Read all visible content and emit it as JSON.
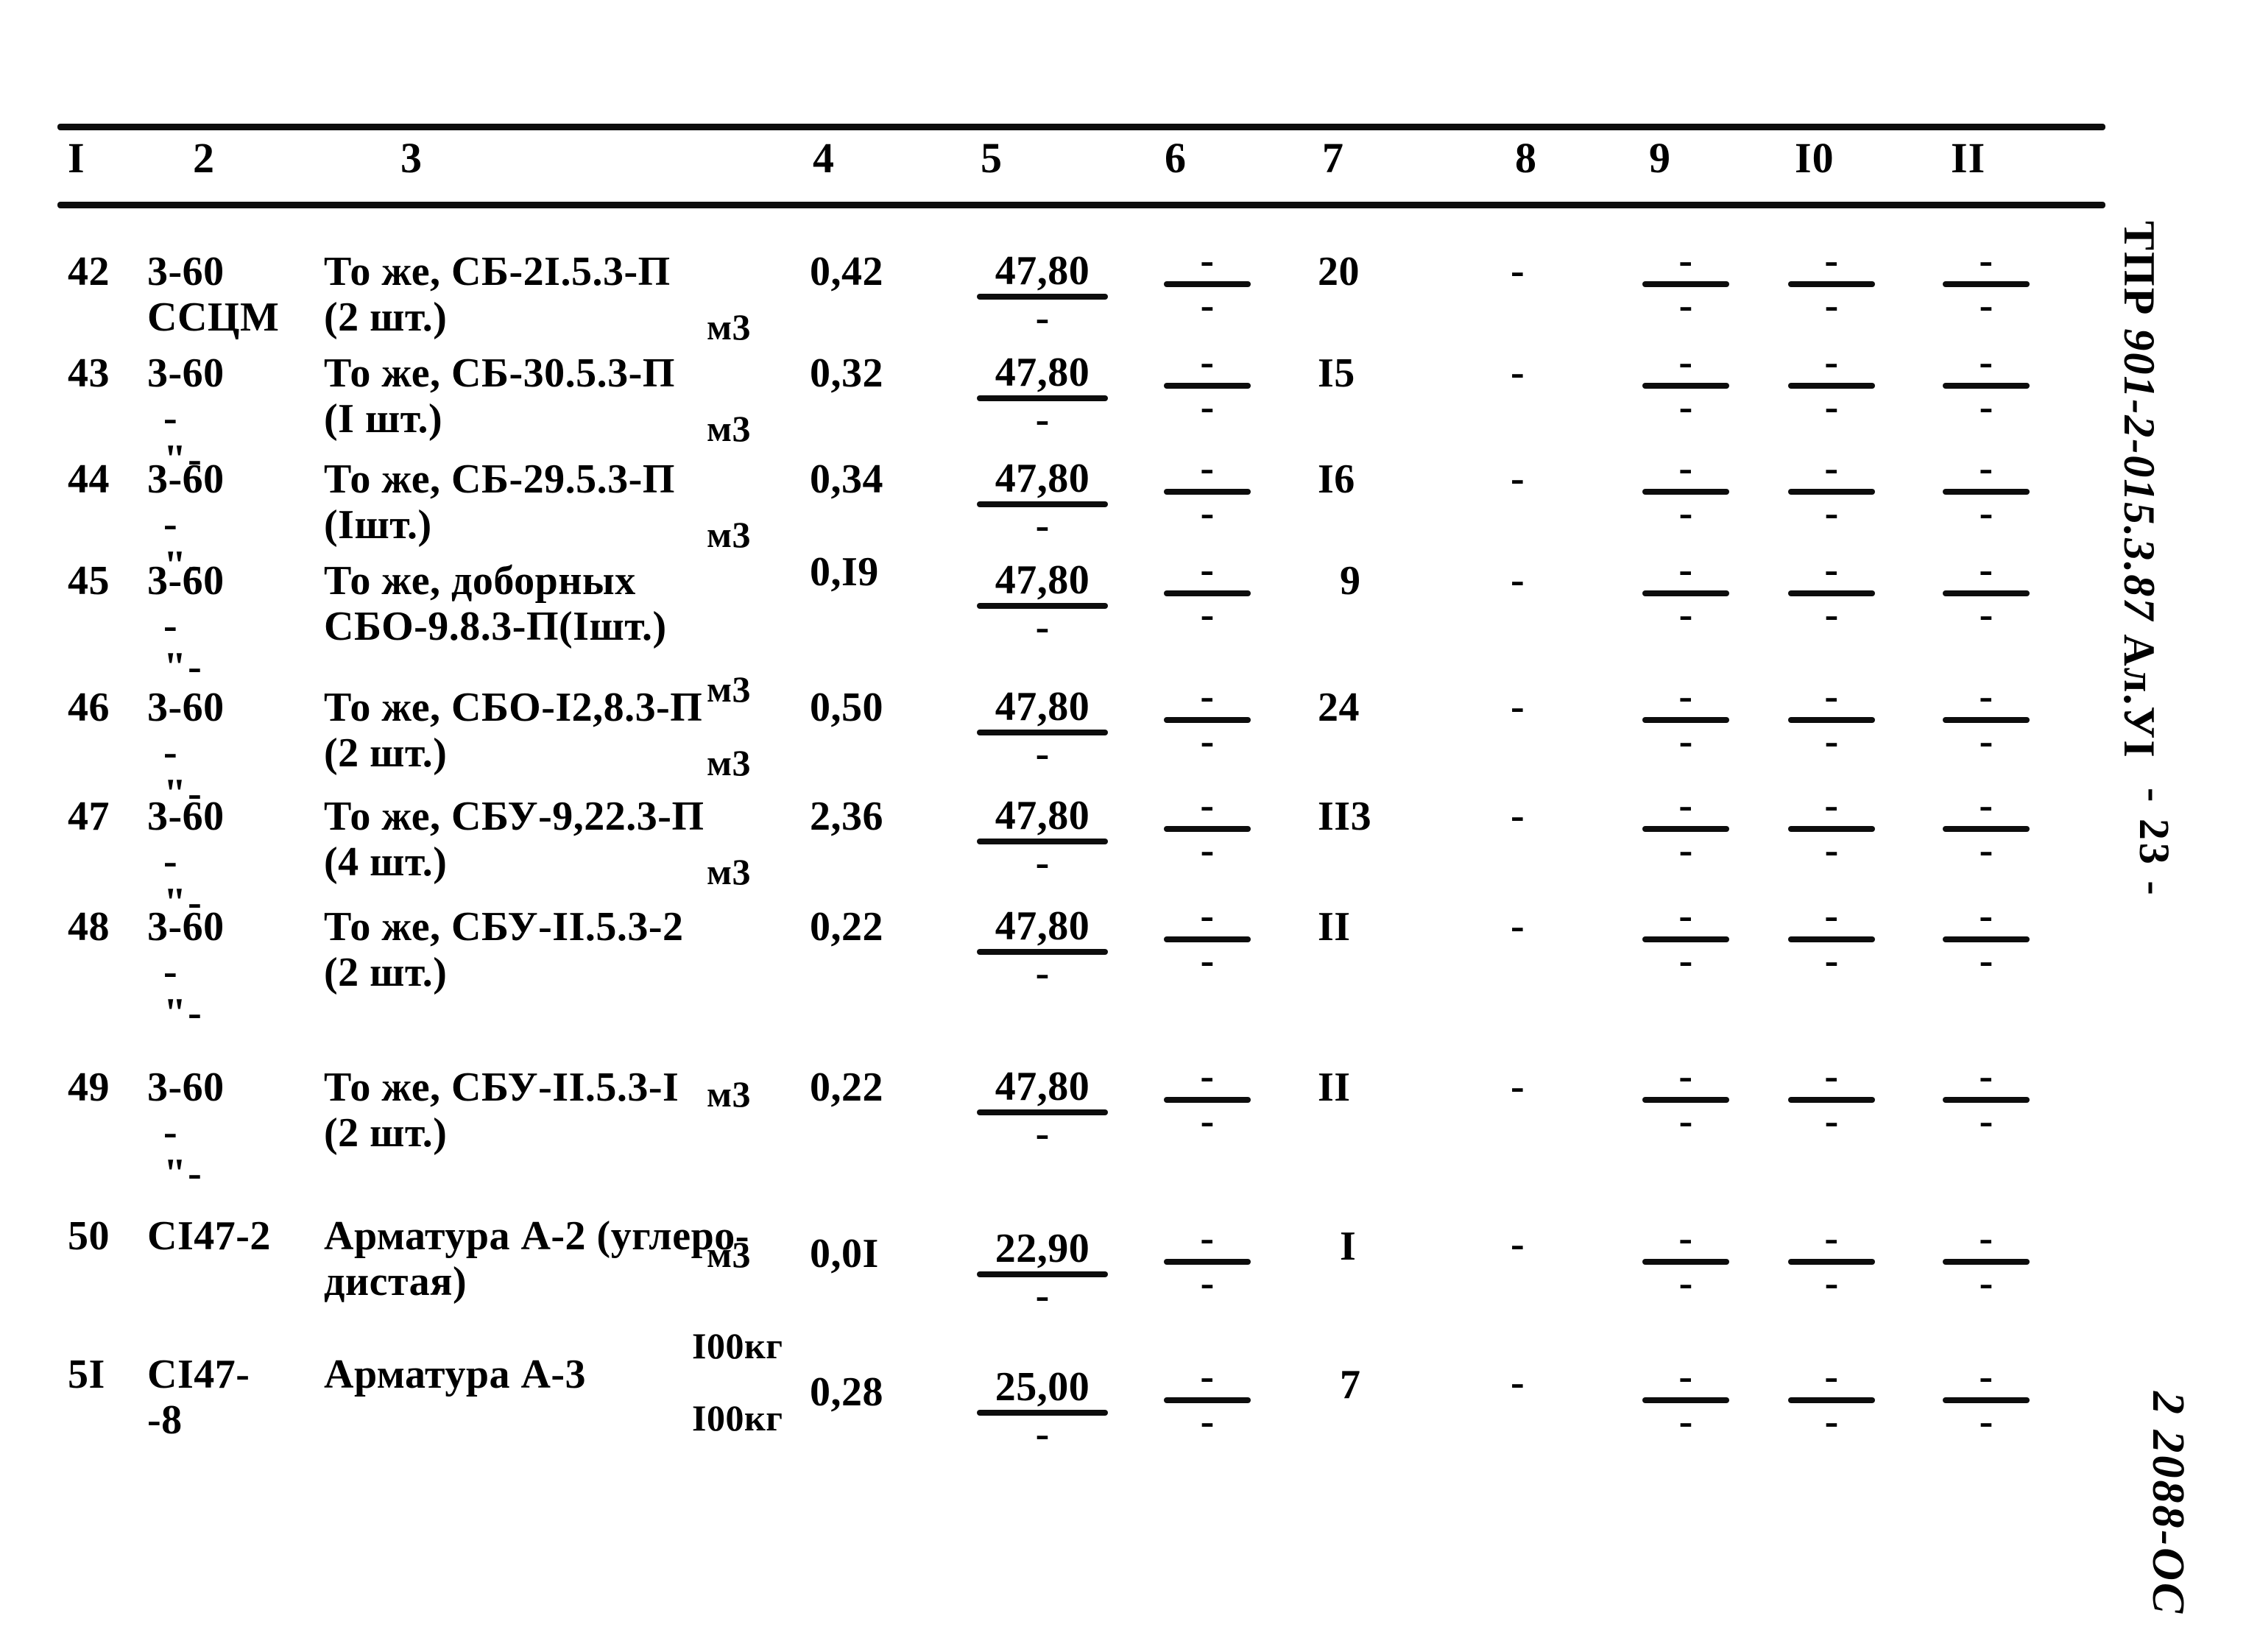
{
  "document": {
    "margin_code": "ТПР 901-2-015.3.87  Ал.УI",
    "page_marker": "- 23 -",
    "bottom_stamp": "2 2088-ОС"
  },
  "table": {
    "headers": [
      "I",
      "2",
      "3",
      "4",
      "5",
      "6",
      "7",
      "8",
      "9",
      "I0",
      "II"
    ],
    "rows": [
      {
        "c1": "42",
        "c2_line1": "3-60",
        "c2_line2": "ССЦМ",
        "c2_is_ditto": false,
        "c3_line1": "То же, СБ-2I.5.3-П",
        "c3_line2": "(2 шт.)",
        "c3_unit": "м3",
        "c4": "0,42",
        "c5_num": "47,80",
        "c5_den": "-",
        "c6_num": "-",
        "c6_den": "-",
        "c7": "20",
        "c8": "-",
        "c9_num": "-",
        "c9_den": "-",
        "c10_num": "-",
        "c10_den": "-",
        "c11_num": "-",
        "c11_den": "-"
      },
      {
        "c1": "43",
        "c2_line1": "3-60",
        "c2_line2": "-\"-",
        "c2_is_ditto": true,
        "c3_line1": "То же, СБ-30.5.3-П",
        "c3_line2": "(I шт.)",
        "c3_unit": "м3",
        "c4": "0,32",
        "c5_num": "47,80",
        "c5_den": "-",
        "c6_num": "-",
        "c6_den": "-",
        "c7": "I5",
        "c8": "-",
        "c9_num": "-",
        "c9_den": "-",
        "c10_num": "-",
        "c10_den": "-",
        "c11_num": "-",
        "c11_den": "-"
      },
      {
        "c1": "44",
        "c2_line1": "3-60",
        "c2_line2": "-\"-",
        "c2_is_ditto": true,
        "c3_line1": "То же, СБ-29.5.3-П",
        "c3_line2": "(Iшт.)",
        "c3_unit": "м3",
        "c4": "0,34",
        "c5_num": "47,80",
        "c5_den": "-",
        "c6_num": "-",
        "c6_den": "-",
        "c7": "I6",
        "c8": "-",
        "c9_num": "-",
        "c9_den": "-",
        "c10_num": "-",
        "c10_den": "-",
        "c11_num": "-",
        "c11_den": "-"
      },
      {
        "c1": "45",
        "c2_line1": "3-60",
        "c2_line2": "-\"-",
        "c2_is_ditto": true,
        "c3_line1": "То же, доборных",
        "c3_line2": "СБО-9.8.3-П(Iшт.)",
        "c3_unit": "м3",
        "c4": "0,I9",
        "c5_num": "47,80",
        "c5_den": "-",
        "c6_num": "-",
        "c6_den": "-",
        "c7": "9",
        "c8": "-",
        "c9_num": "-",
        "c9_den": "-",
        "c10_num": "-",
        "c10_den": "-",
        "c11_num": "-",
        "c11_den": "-"
      },
      {
        "c1": "46",
        "c2_line1": "3-60",
        "c2_line2": "-\"-",
        "c2_is_ditto": true,
        "c3_line1": "То же, СБО-I2,8.3-П",
        "c3_line2": "(2 шт.)",
        "c3_unit": "м3",
        "c4": "0,50",
        "c5_num": "47,80",
        "c5_den": "-",
        "c6_num": "-",
        "c6_den": "-",
        "c7": "24",
        "c8": "-",
        "c9_num": "-",
        "c9_den": "-",
        "c10_num": "-",
        "c10_den": "-",
        "c11_num": "-",
        "c11_den": "-"
      },
      {
        "c1": "47",
        "c2_line1": "3-60",
        "c2_line2": "-\"-",
        "c2_is_ditto": true,
        "c3_line1": "То же, СБУ-9,22.3-П",
        "c3_line2": "(4 шт.)",
        "c3_unit": "м3",
        "c4": "2,36",
        "c5_num": "47,80",
        "c5_den": "-",
        "c6_num": "-",
        "c6_den": "-",
        "c7": "II3",
        "c8": "-",
        "c9_num": "-",
        "c9_den": "-",
        "c10_num": "-",
        "c10_den": "-",
        "c11_num": "-",
        "c11_den": "-"
      },
      {
        "c1": "48",
        "c2_line1": "3-60",
        "c2_line2": "-\"-",
        "c2_is_ditto": true,
        "c3_line1": "То же, СБУ-II.5.3-2",
        "c3_line2": "(2 шт.)",
        "c3_unit": "м3",
        "c4": "0,22",
        "c5_num": "47,80",
        "c5_den": "-",
        "c6_num": "-",
        "c6_den": "-",
        "c7": "II",
        "c8": "-",
        "c9_num": "-",
        "c9_den": "-",
        "c10_num": "-",
        "c10_den": "-",
        "c11_num": "-",
        "c11_den": "-"
      },
      {
        "c1": "49",
        "c2_line1": "3-60",
        "c2_line2": "-\"-",
        "c2_is_ditto": true,
        "c3_line1": "То же, СБУ-II.5.3-I",
        "c3_line2": "(2 шт.)",
        "c3_unit": "м3",
        "c4": "0,22",
        "c5_num": "47,80",
        "c5_den": "-",
        "c6_num": "-",
        "c6_den": "-",
        "c7": "II",
        "c8": "-",
        "c9_num": "-",
        "c9_den": "-",
        "c10_num": "-",
        "c10_den": "-",
        "c11_num": "-",
        "c11_den": "-"
      },
      {
        "c1": "50",
        "c2_line1": "СI47-2",
        "c2_line2": "",
        "c2_is_ditto": false,
        "c3_line1": "Арматура А-2 (углеро-",
        "c3_line2": "дистая)",
        "c3_unit": "I00кг",
        "c4": "0,0I",
        "c5_num": "22,90",
        "c5_den": "-",
        "c6_num": "-",
        "c6_den": "-",
        "c7": "I",
        "c8": "-",
        "c9_num": "-",
        "c9_den": "-",
        "c10_num": "-",
        "c10_den": "-",
        "c11_num": "-",
        "c11_den": "-"
      },
      {
        "c1": "5I",
        "c2_line1": "СI47-",
        "c2_line2": "-8",
        "c2_is_ditto": false,
        "c3_line1": "Арматура А-3",
        "c3_line2": "",
        "c3_unit": "I00кг",
        "c4": "0,28",
        "c5_num": "25,00",
        "c5_den": "-",
        "c6_num": "-",
        "c6_den": "-",
        "c7": "7",
        "c8": "-",
        "c9_num": "-",
        "c9_den": "-",
        "c10_num": "-",
        "c10_den": "-",
        "c11_num": "-",
        "c11_den": "-"
      }
    ]
  }
}
